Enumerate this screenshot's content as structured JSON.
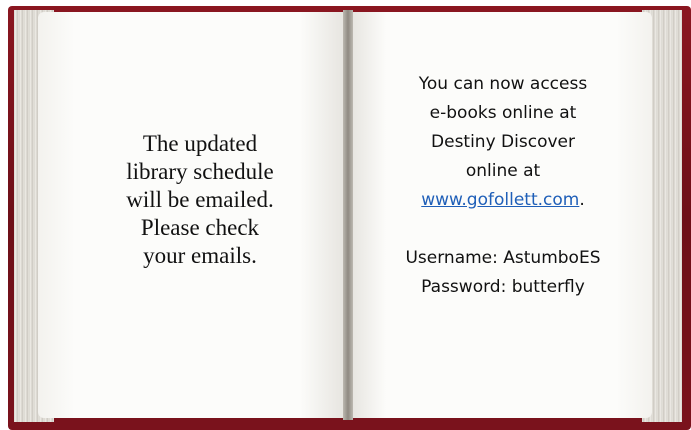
{
  "left_page": {
    "lines": [
      "The updated",
      "library schedule",
      "will be emailed.",
      "Please check",
      "your emails."
    ]
  },
  "right_page": {
    "lines": [
      "You can now access",
      "e-books online at",
      "Destiny Discover",
      "online at"
    ],
    "link_text": "www.gofollett.com",
    "link_suffix": ".",
    "username": "Username: AstumboES",
    "password": "Password: butterfly",
    "link_color": "#1f5fb8"
  },
  "colors": {
    "cover": "#7a121c",
    "page": "#fbfbf9"
  }
}
